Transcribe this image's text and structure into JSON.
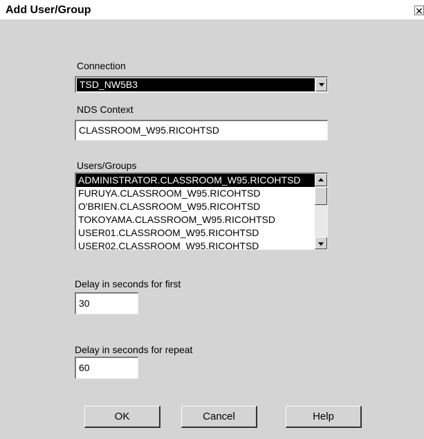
{
  "window": {
    "title": "Add User/Group",
    "close_glyph": "✕"
  },
  "connection": {
    "label": "Connection",
    "selected": "TSD_NW5B3"
  },
  "nds_context": {
    "label": "NDS Context",
    "value": "CLASSROOM_W95.RICOHTSD"
  },
  "users_groups": {
    "label": "Users/Groups",
    "items": [
      "ADMINISTRATOR.CLASSROOM_W95.RICOHTSD",
      "FURUYA.CLASSROOM_W95.RICOHTSD",
      "O'BRIEN.CLASSROOM_W95.RICOHTSD",
      "TOKOYAMA.CLASSROOM_W95.RICOHTSD",
      "USER01.CLASSROOM_W95.RICOHTSD",
      "USER02.CLASSROOM_W95.RICOHTSD"
    ],
    "selected_index": 0
  },
  "delay_first": {
    "label": "Delay in seconds for first",
    "value": "30"
  },
  "delay_repeat": {
    "label": "Delay in seconds for repeat",
    "value": "60"
  },
  "buttons": {
    "ok": "OK",
    "cancel": "Cancel",
    "help": "Help"
  },
  "icons": {
    "close": "close-icon",
    "dropdown": "chevron-down-icon",
    "scroll_up": "arrow-up-icon",
    "scroll_down": "arrow-down-icon"
  },
  "colors": {
    "dialog_bg": "#d4d4d4",
    "selection_bg": "#000000",
    "selection_fg": "#ffffff"
  }
}
